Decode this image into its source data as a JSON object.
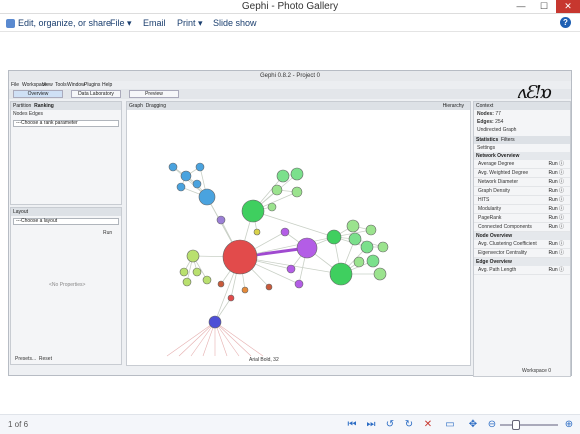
{
  "window": {
    "title": "Gephi - Photo Gallery",
    "min": "—",
    "max": "☐",
    "close": "✕"
  },
  "ribbon": {
    "edit_label": "Edit, organize, or share",
    "file_label": "File ▾",
    "email_label": "Email",
    "print_label": "Print ▾",
    "slideshow_label": "Slide show",
    "help_label": "?"
  },
  "footer": {
    "page_count": "1 of 6"
  },
  "gephi": {
    "title": "Gephi 0.8.2 - Project 0",
    "menu": [
      "File",
      "Workspace",
      "View",
      "Tools",
      "Window",
      "Plugins",
      "Help"
    ],
    "tabs": {
      "overview": "Overview",
      "data_lab": "Data Laboratory",
      "preview": "Preview"
    },
    "partition_tab": "Partition",
    "ranking_tab": "Ranking",
    "nodes_label": "Nodes",
    "edges_label": "Edges",
    "rank_param": "---Choose a rank parameter",
    "layout_tab": "Layout",
    "layout_choose": "---Choose a layout",
    "run_label": "Run",
    "no_props": "<No Properties>",
    "presets": "Presets...",
    "reset": "Reset",
    "graph_tab": "Graph",
    "dragging": "Dragging",
    "hierarchy": "Hierarchy",
    "context": {
      "header": "Context",
      "nodes_label": "Nodes:",
      "nodes_value": "77",
      "edges_label": "Edges:",
      "edges_value": "254",
      "graph_type": "Undirected Graph"
    },
    "statistics_tab": "Statistics",
    "filters_tab": "Filters",
    "settings": "Settings",
    "network_overview": "Network Overview",
    "stats": [
      "Average Degree",
      "Avg. Weighted Degree",
      "Network Diameter",
      "Graph Density",
      "HITS",
      "Modularity",
      "PageRank",
      "Connected Components"
    ],
    "node_overview": "Node Overview",
    "node_stats": [
      "Avg. Clustering Coefficient",
      "Eigenvector Centrality"
    ],
    "edge_overview": "Edge Overview",
    "edge_stats": [
      "Avg. Path Length"
    ],
    "workspace": "Workspace 0",
    "font_label": "Arial Bold, 32"
  },
  "colors": {
    "accent": "#1e5fb3",
    "close": "#c7372f"
  }
}
